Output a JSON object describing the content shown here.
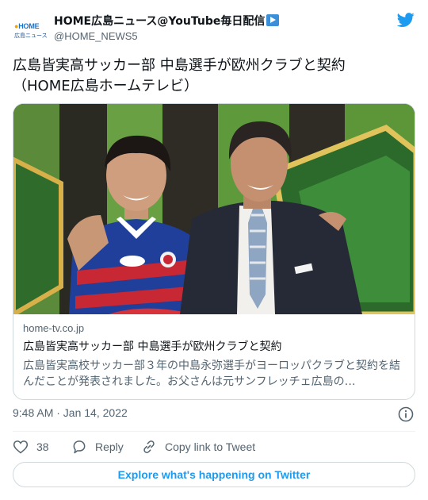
{
  "colors": {
    "accent": "#1d9bf0",
    "text_primary": "#0f1419",
    "text_secondary": "#536471",
    "border": "#cfd9de"
  },
  "author": {
    "display_name": "HOME広島ニュース@YouTube毎日配信",
    "badge_icon": "play-button-emoji",
    "handle": "@HOME_NEWS5",
    "avatar_logo_line1": "HOME",
    "avatar_logo_line2": "広島ニュース"
  },
  "tweet": {
    "text_line1": "広島皆実高サッカー部 中島選手が欧州クラブと契約",
    "text_line2": "（HOME広島ホームテレビ）"
  },
  "card": {
    "image_icon": "press-photo",
    "domain": "home-tv.co.jp",
    "title": "広島皆実高サッカー部 中島選手が欧州クラブと契約",
    "description": "広島皆実高校サッカー部３年の中島永弥選手がヨーロッパクラブと契約を結んだことが発表されました。お父さんは元サンフレッチェ広島の…"
  },
  "meta": {
    "timestamp": "9:48 AM · Jan 14, 2022",
    "info_icon": "info-icon"
  },
  "actions": {
    "like_count": "38",
    "reply_label": "Reply",
    "copy_label": "Copy link to Tweet"
  },
  "explore_label": "Explore what's happening on Twitter"
}
